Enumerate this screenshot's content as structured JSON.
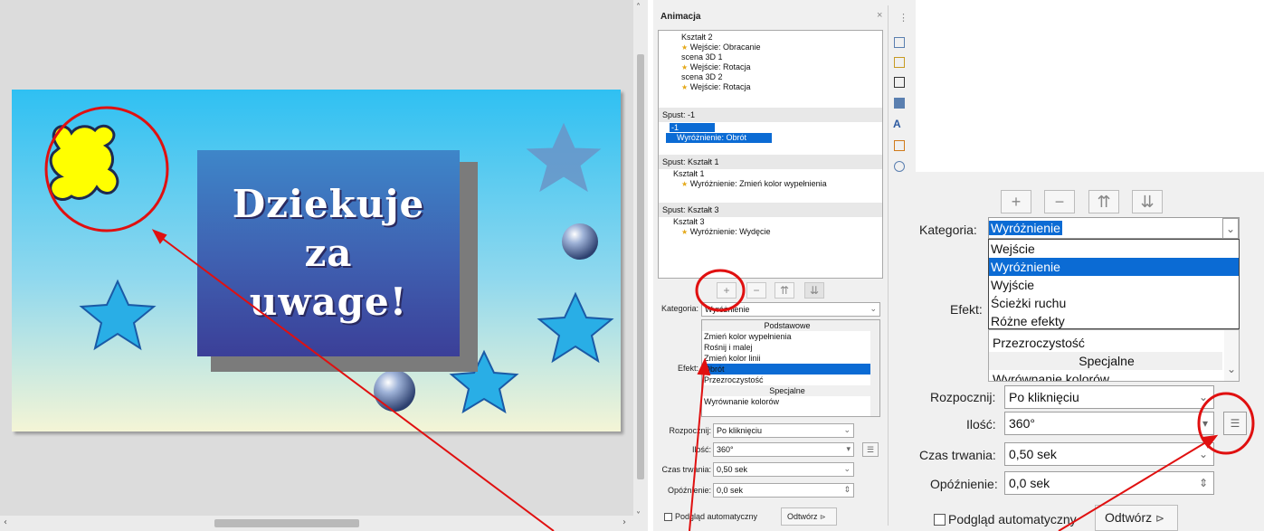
{
  "slide": {
    "line1": "Dziekuje",
    "line2": "za",
    "line3": "uwage!"
  },
  "deck": {
    "title": "Animacja",
    "close": "×",
    "more": "⋮",
    "list": [
      {
        "text": "Kształt 2",
        "kind": "object"
      },
      {
        "text": "Wejście: Obracanie",
        "kind": "effect"
      },
      {
        "text": "scena 3D 1",
        "kind": "object"
      },
      {
        "text": "Wejście: Rotacja",
        "kind": "effect"
      },
      {
        "text": "scena 3D 2",
        "kind": "object"
      },
      {
        "text": "Wejście: Rotacja",
        "kind": "effect"
      }
    ],
    "trigger1": {
      "head": "Spust: -1",
      "obj": "-1",
      "effect": "Wyróżnienie: Obrót"
    },
    "trigger2": {
      "head": "Spust: Kształt 1",
      "obj": "Kształt 1",
      "effect": "Wyróżnienie: Zmień kolor wypełnienia"
    },
    "trigger3": {
      "head": "Spust: Kształt 3",
      "obj": "Kształt 3",
      "effect": "Wyróżnienie: Wydęcie"
    },
    "buttons": {
      "add": "+",
      "remove": "−",
      "up": "⇈",
      "down": "⇊"
    },
    "category_label": "Kategoria:",
    "category_value": "Wyróżnienie",
    "effect_label": "Efekt:",
    "effects": [
      {
        "text": "Podstawowe",
        "head": true
      },
      {
        "text": "Zmień kolor wypełnienia"
      },
      {
        "text": "Rośnij i malej"
      },
      {
        "text": "Zmień kolor linii"
      },
      {
        "text": "Obrót",
        "selected": true
      },
      {
        "text": "Przezroczystość"
      },
      {
        "text": "Specjalne",
        "head": true
      },
      {
        "text": "Wyrównanie kolorów"
      }
    ],
    "start_label": "Rozpocznij:",
    "start_value": "Po kliknięciu",
    "amount_label": "Ilość:",
    "amount_value": "360°",
    "duration_label": "Czas trwania:",
    "duration_value": "0,50 sek",
    "delay_label": "Opóźnienie:",
    "delay_value": "0,0 sek",
    "autopreview_label": "Podgląd automatyczny",
    "play_label": "Odtwórz"
  },
  "zoom": {
    "category_label": "Kategoria:",
    "category_value": "Wyróżnienie",
    "categories": [
      {
        "text": "Wejście"
      },
      {
        "text": "Wyróżnienie",
        "selected": true
      },
      {
        "text": "Wyjście"
      },
      {
        "text": "Ścieżki ruchu"
      },
      {
        "text": "Różne efekty"
      }
    ],
    "effect_label": "Efekt:",
    "effects": [
      {
        "text": "Przezroczystość"
      },
      {
        "text": "Specjalne",
        "head": true
      },
      {
        "text": "Wyrównanie kolorów"
      }
    ],
    "start_label": "Rozpocznij:",
    "start_value": "Po kliknięciu",
    "amount_label": "Ilość:",
    "amount_value": "360°",
    "duration_label": "Czas trwania:",
    "duration_value": "0,50 sek",
    "delay_label": "Opóźnienie:",
    "delay_value": "0,0 sek",
    "autopreview_label": "Podgląd automatyczny",
    "play_label": "Odtwórz"
  },
  "colors": {
    "selection": "#0b6bd4",
    "annotation": "#e01010",
    "slide_top": "#2fc0f2",
    "star": "#29aee6",
    "puzzle": "#ffff00"
  },
  "icons": [
    "puzzle-shape",
    "star-shape",
    "sphere-shape",
    "sidebar-properties-icon",
    "sidebar-styles-icon",
    "sidebar-gallery-icon",
    "sidebar-navigator-icon",
    "sidebar-animation-icon",
    "sidebar-master-slides-icon",
    "sidebar-shapes-icon"
  ]
}
